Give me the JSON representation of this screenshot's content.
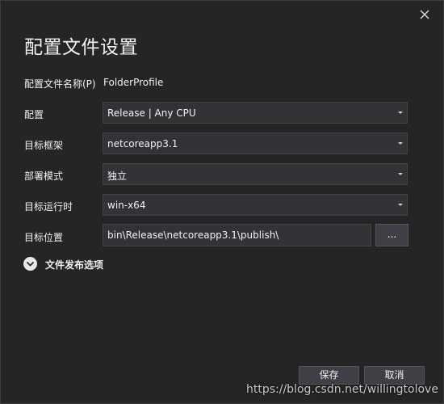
{
  "dialog": {
    "title": "配置文件设置",
    "close_icon": "close-icon"
  },
  "profile_name": {
    "label": "配置文件名称(P)",
    "value": "FolderProfile"
  },
  "fields": {
    "configuration": {
      "label": "配置",
      "value": "Release | Any CPU"
    },
    "target_framework": {
      "label": "目标框架",
      "value": "netcoreapp3.1"
    },
    "deployment_mode": {
      "label": "部署模式",
      "value": "独立"
    },
    "target_runtime": {
      "label": "目标运行时",
      "value": "win-x64"
    },
    "target_location": {
      "label": "目标位置",
      "value": "bin\\Release\\netcoreapp3.1\\publish\\"
    }
  },
  "browse_button": {
    "label": "..."
  },
  "expander": {
    "label": "文件发布选项",
    "icon": "chevron-down-icon"
  },
  "footer": {
    "save_label": "保存",
    "cancel_label": "取消"
  },
  "watermark": "https://blog.csdn.net/willingtolove",
  "colors": {
    "background": "#252526",
    "control": "#333337",
    "border": "#434346",
    "button": "#3f3f46",
    "text": "#f1f1f1"
  }
}
